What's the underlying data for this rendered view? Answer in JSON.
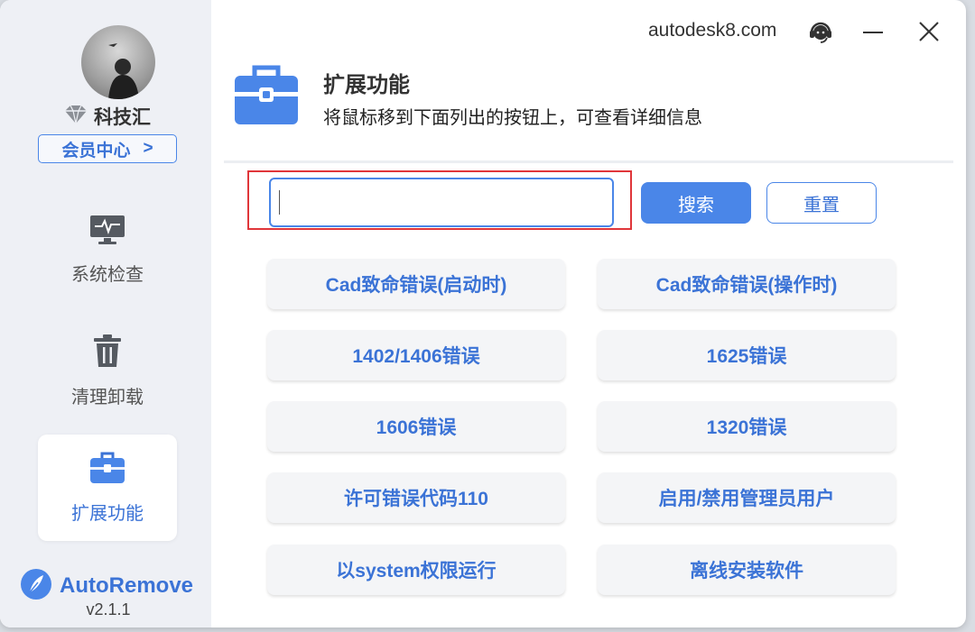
{
  "sidebar": {
    "brand_name": "科技汇",
    "member_center": "会员中心",
    "member_arrow": ">",
    "nav": [
      {
        "label": "系统检查",
        "icon": "monitor-pulse-icon"
      },
      {
        "label": "清理卸载",
        "icon": "trash-icon"
      },
      {
        "label": "扩展功能",
        "icon": "toolbox-icon",
        "active": true
      }
    ],
    "app_name": "AutoRemove",
    "app_version": "v2.1.1"
  },
  "titlebar": {
    "site": "autodesk8.com",
    "icons": [
      "headset-support-icon",
      "minimize-icon",
      "close-icon"
    ]
  },
  "header": {
    "title": "扩展功能",
    "subtitle": "将鼠标移到下面列出的按钮上，可查看详细信息",
    "icon": "toolbox-icon"
  },
  "search": {
    "value": "",
    "search_label": "搜索",
    "reset_label": "重置"
  },
  "functions": [
    "Cad致命错误(启动时)",
    "Cad致命错误(操作时)",
    "1402/1406错误",
    "1625错误",
    "1606错误",
    "1320错误",
    "许可错误代码110",
    "启用/禁用管理员用户",
    "以system权限运行",
    "离线安装软件"
  ],
  "colors": {
    "accent": "#4a86e8",
    "accent_text": "#3b73d6",
    "highlight": "#e0363a",
    "sidebar_bg": "#eef0f5"
  }
}
